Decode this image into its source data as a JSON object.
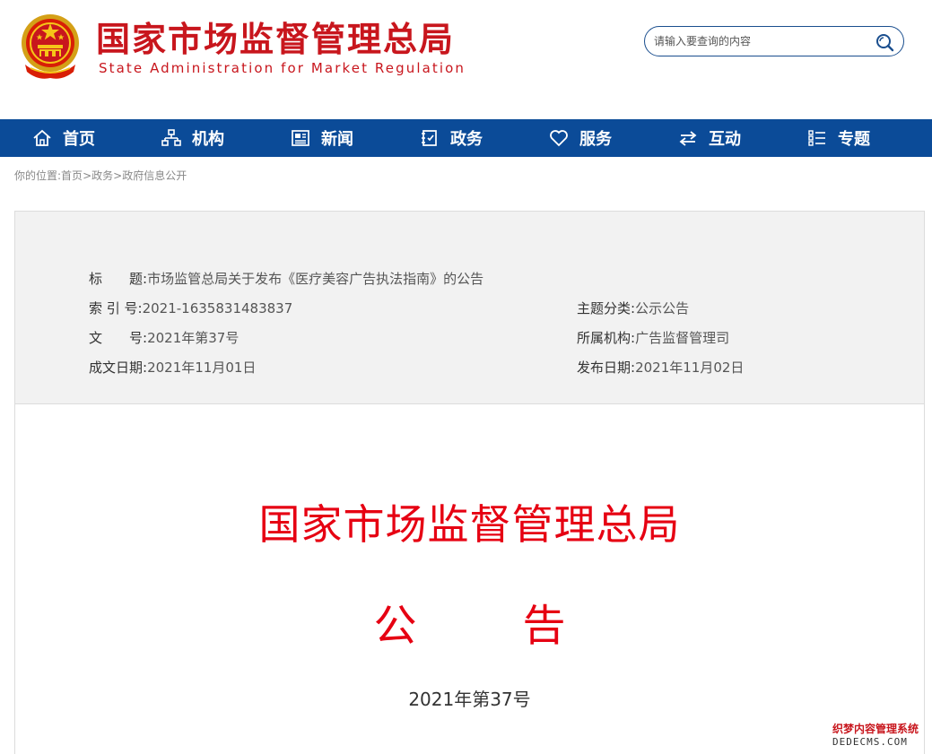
{
  "header": {
    "title": "国家市场监督管理总局",
    "subtitle": "State Administration for Market Regulation",
    "search_placeholder": "请输入要查询的内容"
  },
  "nav": {
    "items": [
      {
        "label": "首页",
        "icon": "home-icon"
      },
      {
        "label": "机构",
        "icon": "org-chart-icon"
      },
      {
        "label": "新闻",
        "icon": "newspaper-icon"
      },
      {
        "label": "政务",
        "icon": "document-icon"
      },
      {
        "label": "服务",
        "icon": "heart-icon"
      },
      {
        "label": "互动",
        "icon": "exchange-icon"
      },
      {
        "label": "专题",
        "icon": "list-icon"
      }
    ]
  },
  "breadcrumb": {
    "prefix": "你的位置:",
    "items": [
      "首页",
      "政务",
      "政府信息公开"
    ],
    "separator": ">"
  },
  "info": {
    "title_label": "标　　题:",
    "title_value": "市场监管总局关于发布《医疗美容广告执法指南》的公告",
    "index_label": "索 引 号:",
    "index_value": "2021-1635831483837",
    "topic_label": "主题分类:",
    "topic_value": "公示公告",
    "docno_label": "文　　号:",
    "docno_value": "2021年第37号",
    "org_label": "所属机构:",
    "org_value": "广告监督管理司",
    "created_label": "成文日期:",
    "created_value": "2021年11月01日",
    "published_label": "发布日期:",
    "published_value": "2021年11月02日"
  },
  "document": {
    "org_name": "国家市场监督管理总局",
    "type_char1": "公",
    "type_char2": "告",
    "number": "2021年第37号"
  },
  "watermark": {
    "line1": "织梦内容管理系统",
    "line2": "DEDECMS.COM"
  },
  "colors": {
    "brand_red": "#c8161d",
    "doc_red": "#e60012",
    "nav_blue": "#0b4b98"
  }
}
